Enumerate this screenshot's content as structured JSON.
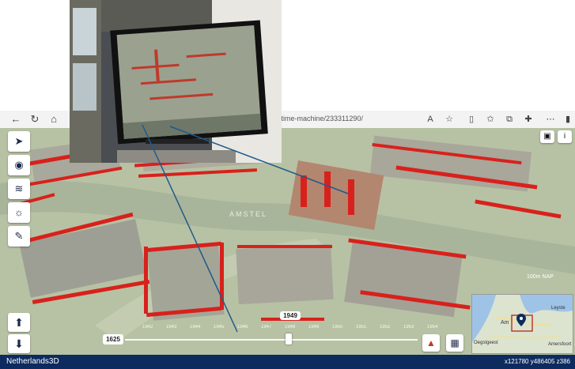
{
  "browser": {
    "url_fragment": "m-time-machine/233311290/",
    "back_icon": "back-arrow-icon",
    "refresh_icon": "refresh-icon",
    "home_icon": "home-icon"
  },
  "map": {
    "river_label": "AMSTEL",
    "scale_label": "100m NAP",
    "left_tools": [
      {
        "name": "select-tool-button",
        "icon": "cursor-icon"
      },
      {
        "name": "camera-view-button",
        "icon": "view-icon"
      },
      {
        "name": "layers-button",
        "icon": "layers-icon"
      },
      {
        "name": "sun-button",
        "icon": "sun-icon"
      },
      {
        "name": "edit-button",
        "icon": "edit-icon"
      }
    ]
  },
  "timeline": {
    "start_year": "1625",
    "current_year": "1949",
    "ticks": [
      "1942",
      "1943",
      "1944",
      "1945",
      "1946",
      "1947",
      "1948",
      "1949",
      "1950",
      "1951",
      "1952",
      "1953",
      "1954"
    ]
  },
  "minimap": {
    "label_a": "Am",
    "label_b": "Leyste",
    "label_c": "Oegstgeest",
    "label_d": "Amersfoort"
  },
  "status": {
    "brand": "Netherlands3D",
    "coords": "x121780 y486405 z386"
  },
  "colors": {
    "status_bg": "#0d2b5e",
    "building_red": "#d8211c",
    "map_ground": "#b9c4a6"
  }
}
